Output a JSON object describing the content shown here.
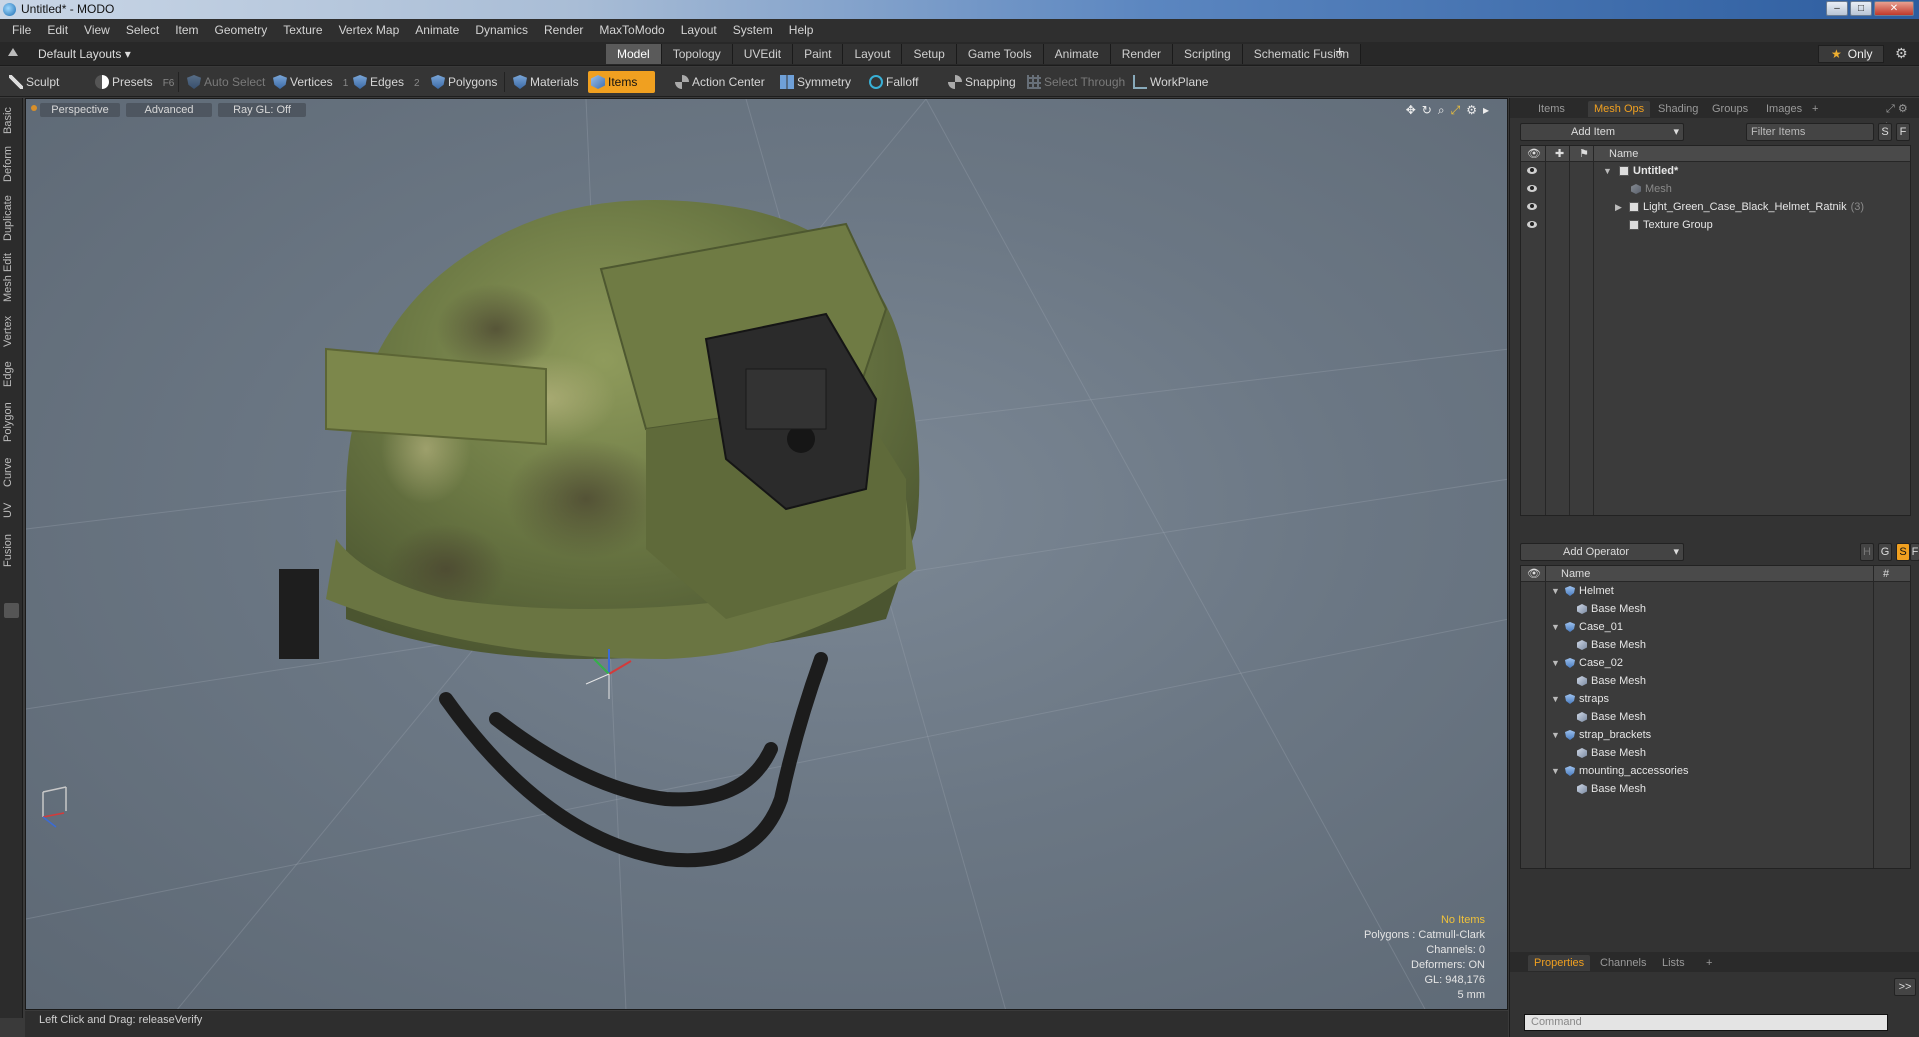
{
  "window": {
    "title": "Untitled* - MODO"
  },
  "menu": [
    "File",
    "Edit",
    "View",
    "Select",
    "Item",
    "Geometry",
    "Texture",
    "Vertex Map",
    "Animate",
    "Dynamics",
    "Render",
    "MaxToModo",
    "Layout",
    "System",
    "Help"
  ],
  "layoutbar": {
    "default_layouts": "Default Layouts ▾",
    "tabs": [
      "Model",
      "Topology",
      "UVEdit",
      "Paint",
      "Layout",
      "Setup",
      "Game Tools",
      "Animate",
      "Render",
      "Scripting",
      "Schematic Fusion"
    ],
    "active_tab": "Model",
    "plus": "+",
    "only": "Only"
  },
  "toolbar": {
    "sculpt": "Sculpt",
    "presets": "Presets",
    "presets_key": "F6",
    "auto_select": "Auto Select",
    "vertices": "Vertices",
    "vertices_key": "1",
    "edges": "Edges",
    "edges_key": "2",
    "polygons": "Polygons",
    "materials": "Materials",
    "items": "Items",
    "action_center": "Action Center",
    "symmetry": "Symmetry",
    "falloff": "Falloff",
    "snapping": "Snapping",
    "select_through": "Select Through",
    "workplane": "WorkPlane"
  },
  "lefttabs": [
    "Basic",
    "Deform",
    "Duplicate",
    "Mesh Edit",
    "Vertex",
    "Edge",
    "Polygon",
    "Curve",
    "UV",
    "Fusion"
  ],
  "viewport": {
    "view_mode": "Perspective",
    "shading": "Advanced",
    "raygl": "Ray GL: Off",
    "stats": {
      "no_items": "No Items",
      "polygons": "Polygons : Catmull-Clark",
      "channels": "Channels: 0",
      "deformers": "Deformers: ON",
      "gl": "GL: 948,176",
      "unit": "5 mm"
    }
  },
  "statusbar": {
    "text": "Left Click and Drag:   releaseVerify"
  },
  "items_panel": {
    "tabs": [
      "Items",
      "Mesh Ops",
      "Shading",
      "Groups",
      "Images"
    ],
    "active_tab": "Mesh Ops",
    "plus": "+",
    "add_item": "Add Item",
    "filter_placeholder": "Filter Items",
    "s_btn": "S",
    "f_btn": "F",
    "col_name": "Name",
    "rows": [
      {
        "label": "Untitled*",
        "bold": true,
        "dim": false,
        "count": ""
      },
      {
        "label": "Mesh",
        "bold": false,
        "dim": true,
        "count": ""
      },
      {
        "label": "Light_Green_Case_Black_Helmet_Ratnik",
        "bold": false,
        "dim": false,
        "count": "(3)"
      },
      {
        "label": "Texture Group",
        "bold": false,
        "dim": false,
        "count": ""
      }
    ]
  },
  "meshops_panel": {
    "add_operator": "Add Operator",
    "h_btn": "H",
    "g_btn": "G",
    "s_btn": "S",
    "f_btn": "F",
    "col_name": "Name",
    "col_hash": "#",
    "items": [
      {
        "name": "Helmet",
        "child": "Base Mesh"
      },
      {
        "name": "Case_01",
        "child": "Base Mesh"
      },
      {
        "name": "Case_02",
        "child": "Base Mesh"
      },
      {
        "name": "straps",
        "child": "Base Mesh"
      },
      {
        "name": "strap_brackets",
        "child": "Base Mesh"
      },
      {
        "name": "mounting_accessories",
        "child": "Base Mesh"
      }
    ]
  },
  "props_panel": {
    "tabs": [
      "Properties",
      "Channels",
      "Lists"
    ],
    "active_tab": "Properties",
    "plus": "+",
    "expand": ">>",
    "command_placeholder": "Command"
  },
  "colors": {
    "accent": "#f0a020",
    "viewport_bg": "#6b7784",
    "stat_highlight": "#f0c23a"
  }
}
